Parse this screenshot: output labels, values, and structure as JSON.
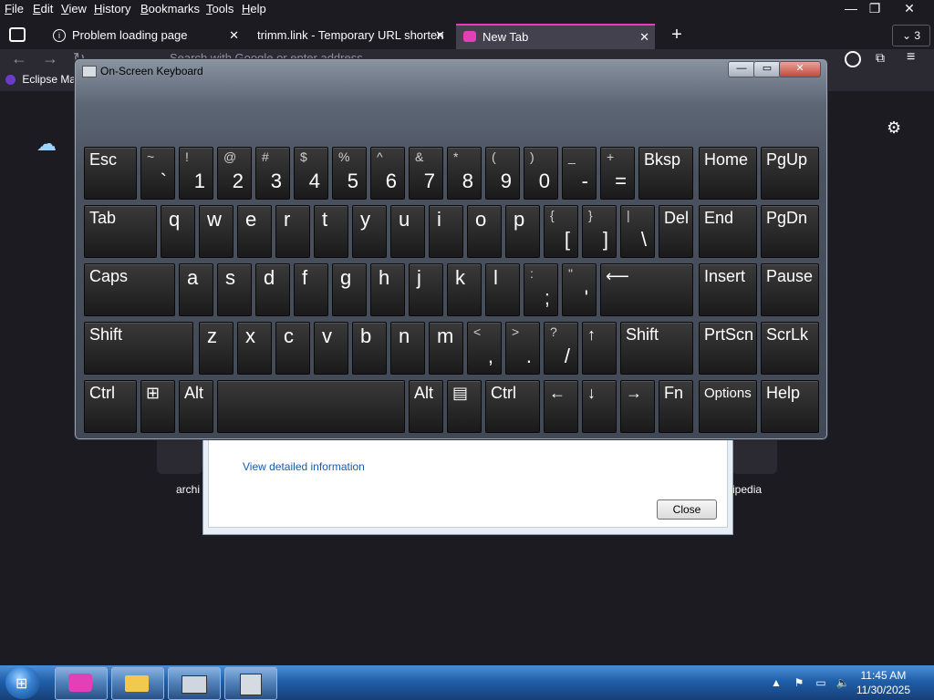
{
  "menubar": {
    "items": [
      {
        "label": "File",
        "u": "F",
        "rest": "ile"
      },
      {
        "label": "Edit",
        "u": "E",
        "rest": "dit"
      },
      {
        "label": "View",
        "u": "V",
        "rest": "iew"
      },
      {
        "label": "History",
        "u": "H",
        "rest": "istory"
      },
      {
        "label": "Bookmarks",
        "u": "B",
        "rest": "ookmarks"
      },
      {
        "label": "Tools",
        "u": "T",
        "rest": "ools"
      },
      {
        "label": "Help",
        "u": "H",
        "rest": "elp"
      }
    ],
    "window_controls": {
      "minimize": "—",
      "maximize": "❐",
      "close": "✕"
    }
  },
  "tabs": [
    {
      "label": "Problem loading page",
      "icon": "info-icon"
    },
    {
      "label": "trimm.link - Temporary URL shorten",
      "icon": "none"
    },
    {
      "label": "New Tab",
      "icon": "firefox-icon",
      "active": true
    }
  ],
  "tab_count": "3",
  "new_tab_label": "+",
  "urlbar": {
    "placeholder": "Search with Google or enter address"
  },
  "bookmarks": {
    "first_item": "Eclipse Ma"
  },
  "dialog": {
    "link": "View detailed information",
    "close_label": "Close"
  },
  "shortcuts": {
    "left_label": "archi",
    "right_label": "ipedia"
  },
  "osk": {
    "title": "On-Screen Keyboard",
    "buttons": {
      "minimize": "—",
      "restore": "▭",
      "close": "✕"
    },
    "rows": [
      [
        {
          "id": "esc",
          "label": "Esc"
        },
        {
          "id": "backtick",
          "top": "~",
          "bot": "`"
        },
        {
          "id": "1",
          "top": "!",
          "bot": "1"
        },
        {
          "id": "2",
          "top": "@",
          "bot": "2"
        },
        {
          "id": "3",
          "top": "#",
          "bot": "3"
        },
        {
          "id": "4",
          "top": "$",
          "bot": "4"
        },
        {
          "id": "5",
          "top": "%",
          "bot": "5"
        },
        {
          "id": "6",
          "top": "^",
          "bot": "6"
        },
        {
          "id": "7",
          "top": "&",
          "bot": "7"
        },
        {
          "id": "8",
          "top": "*",
          "bot": "8"
        },
        {
          "id": "9",
          "top": "(",
          "bot": "9"
        },
        {
          "id": "0",
          "top": ")",
          "bot": "0"
        },
        {
          "id": "minus",
          "top": "_",
          "bot": "-"
        },
        {
          "id": "equal",
          "top": "+",
          "bot": "="
        },
        {
          "id": "bksp",
          "label": "Bksp"
        },
        {
          "id": "home",
          "label": "Home"
        },
        {
          "id": "pgup",
          "label": "PgUp"
        }
      ],
      [
        {
          "id": "tab",
          "label": "Tab"
        },
        {
          "id": "q",
          "label": "q"
        },
        {
          "id": "w",
          "label": "w"
        },
        {
          "id": "e",
          "label": "e"
        },
        {
          "id": "r",
          "label": "r"
        },
        {
          "id": "t",
          "label": "t"
        },
        {
          "id": "y",
          "label": "y"
        },
        {
          "id": "u",
          "label": "u"
        },
        {
          "id": "i",
          "label": "i"
        },
        {
          "id": "o",
          "label": "o"
        },
        {
          "id": "p",
          "label": "p"
        },
        {
          "id": "lbracket",
          "top": "{",
          "bot": "["
        },
        {
          "id": "rbracket",
          "top": "}",
          "bot": "]"
        },
        {
          "id": "backslash",
          "top": "|",
          "bot": "\\"
        },
        {
          "id": "del",
          "label": "Del"
        },
        {
          "id": "end",
          "label": "End"
        },
        {
          "id": "pgdn",
          "label": "PgDn"
        }
      ],
      [
        {
          "id": "caps",
          "label": "Caps"
        },
        {
          "id": "a",
          "label": "a"
        },
        {
          "id": "s",
          "label": "s"
        },
        {
          "id": "d",
          "label": "d"
        },
        {
          "id": "f",
          "label": "f"
        },
        {
          "id": "g",
          "label": "g"
        },
        {
          "id": "h",
          "label": "h"
        },
        {
          "id": "j",
          "label": "j"
        },
        {
          "id": "k",
          "label": "k"
        },
        {
          "id": "l",
          "label": "l"
        },
        {
          "id": "semicolon",
          "top": ":",
          "bot": ";"
        },
        {
          "id": "quote",
          "top": "\"",
          "bot": "'"
        },
        {
          "id": "enter",
          "label": "⟵"
        },
        {
          "id": "insert",
          "label": "Insert"
        },
        {
          "id": "pause",
          "label": "Pause"
        }
      ],
      [
        {
          "id": "lshift",
          "label": "Shift"
        },
        {
          "id": "z",
          "label": "z"
        },
        {
          "id": "x",
          "label": "x"
        },
        {
          "id": "c",
          "label": "c"
        },
        {
          "id": "v",
          "label": "v"
        },
        {
          "id": "b",
          "label": "b"
        },
        {
          "id": "n",
          "label": "n"
        },
        {
          "id": "m",
          "label": "m"
        },
        {
          "id": "comma",
          "top": "<",
          "bot": ","
        },
        {
          "id": "period",
          "top": ">",
          "bot": "."
        },
        {
          "id": "slash",
          "top": "?",
          "bot": "/"
        },
        {
          "id": "up",
          "label": "↑"
        },
        {
          "id": "rshift",
          "label": "Shift"
        },
        {
          "id": "prtscn",
          "label": "PrtScn"
        },
        {
          "id": "scrlk",
          "label": "ScrLk"
        }
      ],
      [
        {
          "id": "lctrl",
          "label": "Ctrl"
        },
        {
          "id": "win",
          "label": "⊞"
        },
        {
          "id": "lalt",
          "label": "Alt"
        },
        {
          "id": "space",
          "label": ""
        },
        {
          "id": "ralt",
          "label": "Alt"
        },
        {
          "id": "menu",
          "label": "▤"
        },
        {
          "id": "rctrl",
          "label": "Ctrl"
        },
        {
          "id": "left",
          "label": "←"
        },
        {
          "id": "down",
          "label": "↓"
        },
        {
          "id": "right",
          "label": "→"
        },
        {
          "id": "fn",
          "label": "Fn"
        },
        {
          "id": "options",
          "label": "Options"
        },
        {
          "id": "help",
          "label": "Help"
        }
      ]
    ]
  },
  "taskbar": {
    "clock_time": "11:45 AM",
    "clock_date": "11/30/2025"
  }
}
